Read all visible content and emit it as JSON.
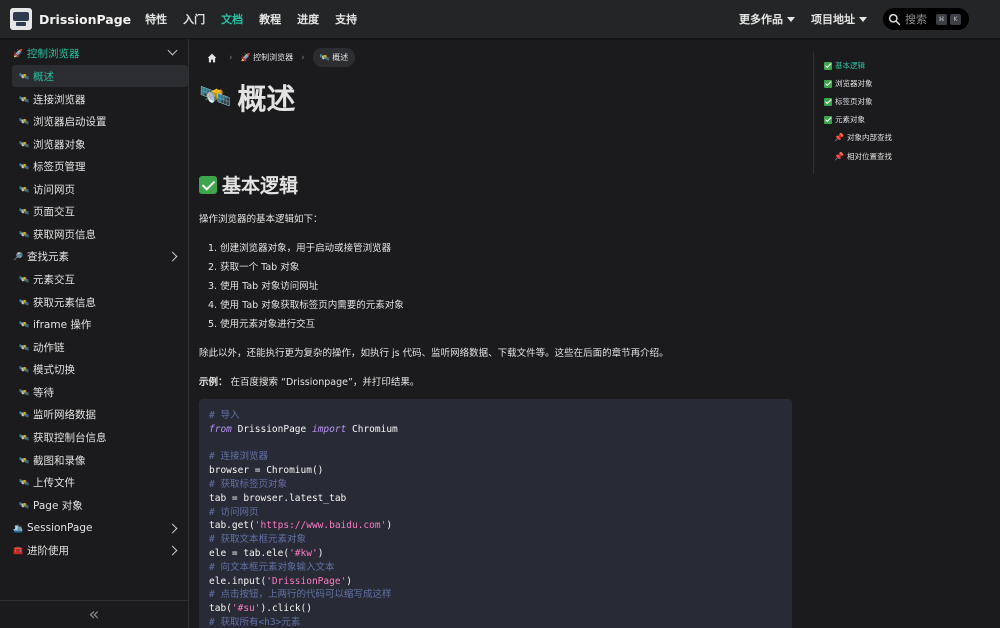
{
  "navbar": {
    "brand": "DrissionPage",
    "links": [
      "特性",
      "入门",
      "文档",
      "教程",
      "进度",
      "支持"
    ],
    "active_link": "文档",
    "more_works": "更多作品",
    "project_address": "项目地址",
    "search_placeholder": "搜索",
    "kbd_keys": [
      "⌘",
      "K"
    ]
  },
  "sidebar": {
    "category": "控制浏览器",
    "items": [
      "概述",
      "连接浏览器",
      "浏览器启动设置",
      "浏览器对象",
      "标签页管理",
      "访问网页",
      "页面交互",
      "获取网页信息",
      "查找元素",
      "元素交互",
      "获取元素信息",
      "iframe 操作",
      "动作链",
      "模式切换",
      "等待",
      "监听网络数据",
      "获取控制台信息",
      "截图和录像",
      "上传文件",
      "Page 对象"
    ],
    "bottom_categories": [
      "SessionPage",
      "进阶使用"
    ],
    "collapse_icon": "«"
  },
  "breadcrumb": {
    "home_icon": "home-icon",
    "parent": "控制浏览器",
    "current": "概述"
  },
  "content": {
    "title": "概述",
    "section_title": "基本逻辑",
    "intro": "操作浏览器的基本逻辑如下：",
    "steps": [
      "1. 创建浏览器对象，用于启动或接管浏览器",
      "2. 获取一个 Tab 对象",
      "3. 使用 Tab 对象访问网址",
      "4. 使用 Tab 对象获取标签页内需要的元素对象",
      "5. 使用元素对象进行交互"
    ],
    "more": "除此以外，还能执行更为复杂的操作，如执行 js 代码、监听网络数据、下载文件等。这些在后面的章节再介绍。",
    "example_label": "示例：",
    "example_text": "在百度搜索 “Drissionpage”，并打印结果。",
    "code": {
      "c1": "# 导入",
      "l2_kw1": "from",
      "l2_mid": " DrissionPage ",
      "l2_kw2": "import",
      "l2_end": " Chromium",
      "c4": "# 连接浏览器",
      "l5": "browser = Chromium()",
      "c6": "# 获取标签页对象",
      "l7": "tab = browser.latest_tab",
      "c8": "# 访问网页",
      "l9_a": "tab.get(",
      "l9_s": "'https://www.baidu.com'",
      "l9_b": ")",
      "c10": "# 获取文本框元素对象",
      "l11_a": "ele = tab.ele(",
      "l11_s": "'#kw'",
      "l11_b": ")",
      "c12": "# 向文本框元素对象输入文本",
      "l13_a": "ele.input(",
      "l13_s": "'DrissionPage'",
      "l13_b": ")",
      "c14": "# 点击按钮，上两行的代码可以缩写成这样",
      "l15_a": "tab(",
      "l15_s": "'#su'",
      "l15_b": ").click()",
      "c16": "# 获取所有<h3>元素"
    }
  },
  "toc": {
    "items": [
      "基本逻辑",
      "浏览器对象",
      "标签页对象",
      "元素对象"
    ],
    "subitems": [
      "对象内部查找",
      "相对位置查找"
    ]
  },
  "colors": {
    "accent": "#25c2a0",
    "background": "#1b1b1d",
    "navbar": "#242526",
    "code_bg": "#282a36"
  }
}
